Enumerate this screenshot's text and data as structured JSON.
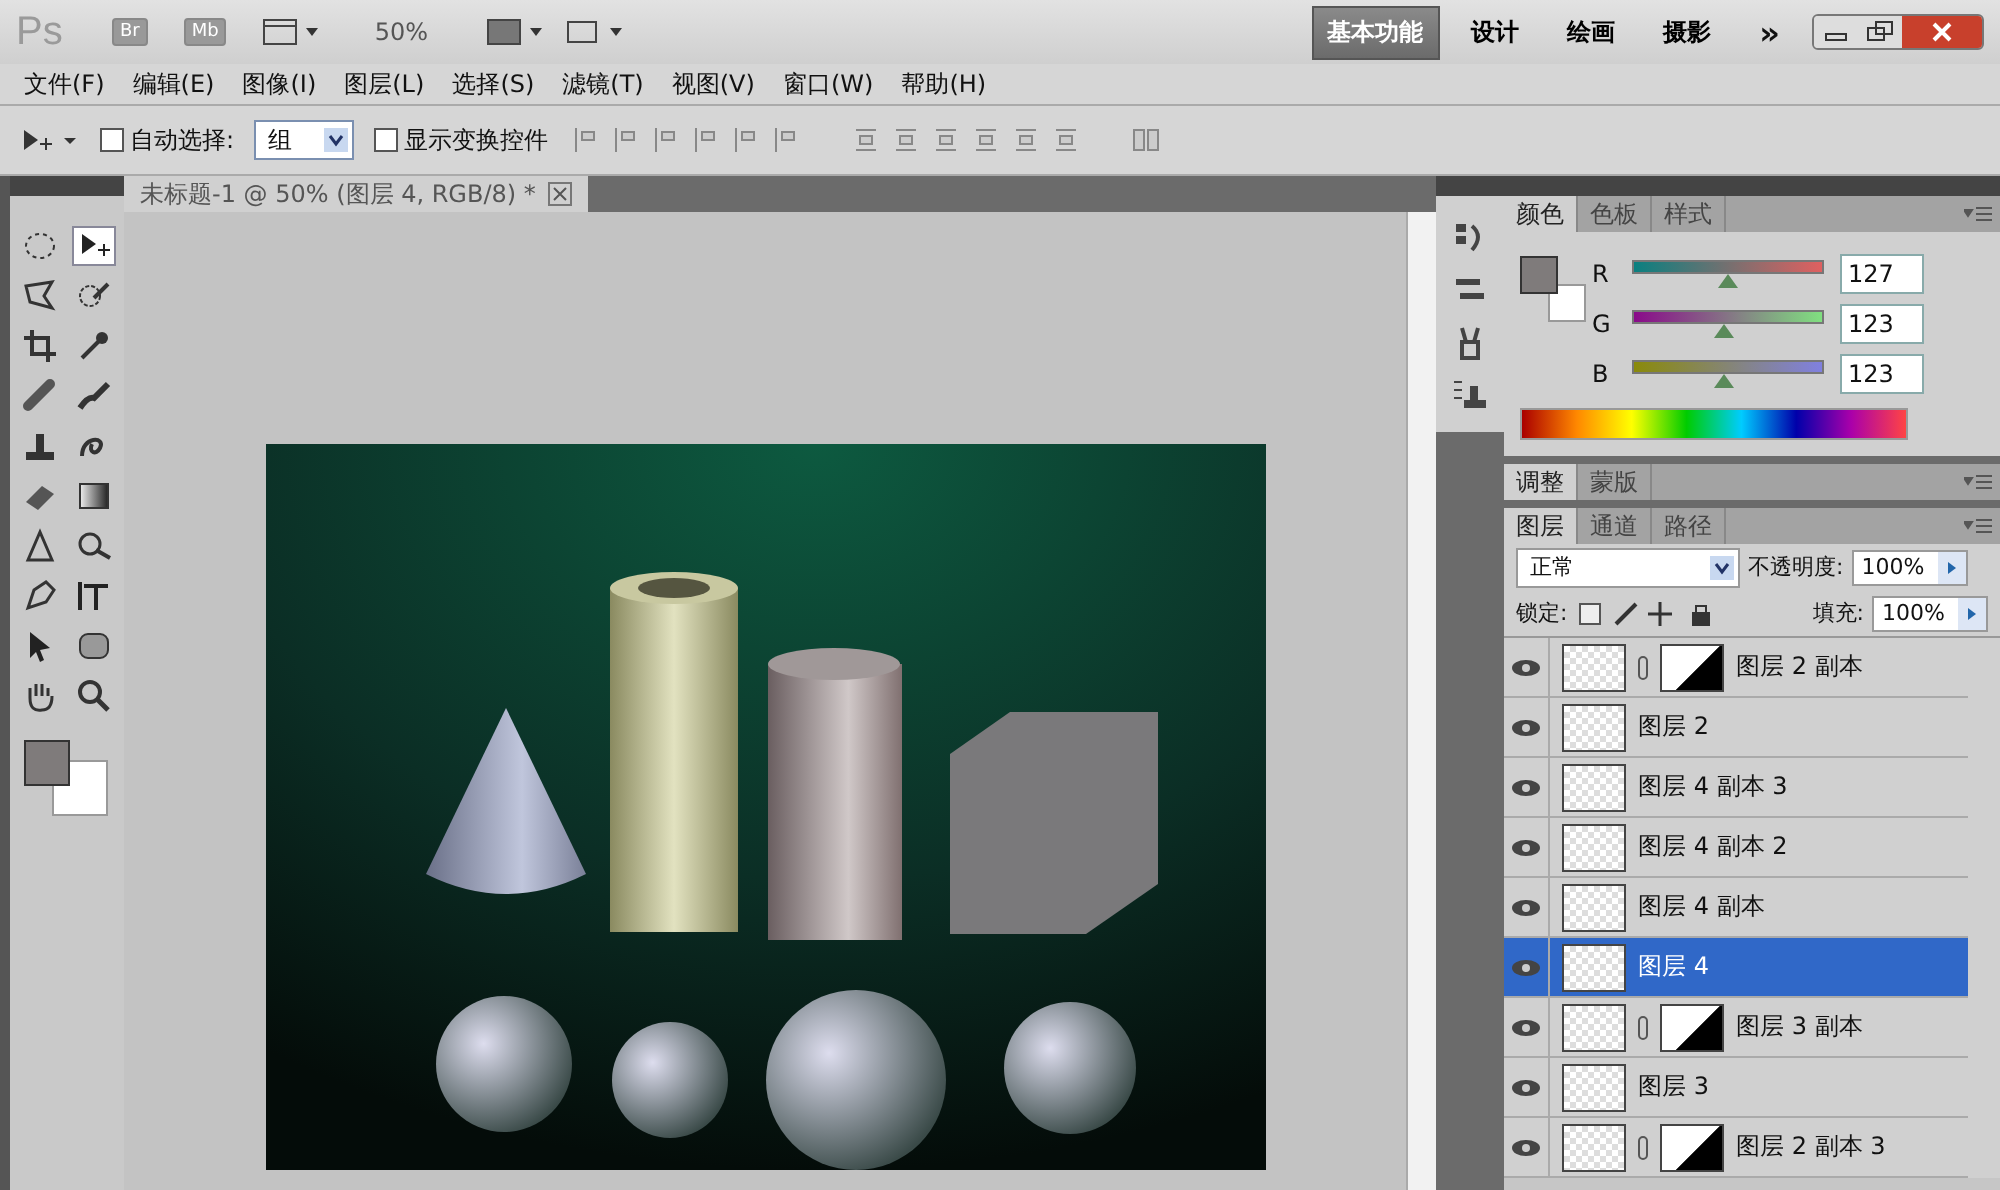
{
  "app_bar": {
    "logo": "Ps",
    "bridge": "Br",
    "mini_bridge": "Mb",
    "zoom": "50%",
    "more": "»",
    "workspaces": [
      {
        "label": "基本功能",
        "selected": true
      },
      {
        "label": "设计",
        "selected": false
      },
      {
        "label": "绘画",
        "selected": false
      },
      {
        "label": "摄影",
        "selected": false
      }
    ]
  },
  "menu": [
    "文件(F)",
    "编辑(E)",
    "图像(I)",
    "图层(L)",
    "选择(S)",
    "滤镜(T)",
    "视图(V)",
    "窗口(W)",
    "帮助(H)"
  ],
  "options_bar": {
    "auto_select": {
      "label": "自动选择:",
      "checked": false
    },
    "auto_select_mode": "组",
    "show_transform": {
      "label": "显示变换控件",
      "checked": false
    }
  },
  "document": {
    "tab_title": "未标题-1 @ 50% (图层 4, RGB/8) *"
  },
  "color_panel": {
    "tabs": [
      {
        "label": "颜色",
        "selected": true
      },
      {
        "label": "色板",
        "selected": false
      },
      {
        "label": "样式",
        "selected": false
      }
    ],
    "channels": [
      {
        "name": "R",
        "value": "127",
        "level": 0.5
      },
      {
        "name": "G",
        "value": "123",
        "level": 0.48
      },
      {
        "name": "B",
        "value": "123",
        "level": 0.48
      }
    ]
  },
  "adjust_panel": {
    "tabs": [
      {
        "label": "调整",
        "selected": true
      },
      {
        "label": "蒙版",
        "selected": false
      }
    ]
  },
  "layers_panel": {
    "tabs": [
      {
        "label": "图层",
        "selected": true
      },
      {
        "label": "通道",
        "selected": false
      },
      {
        "label": "路径",
        "selected": false
      }
    ],
    "blend_mode": "正常",
    "opacity_label": "不透明度:",
    "opacity": "100%",
    "lock_label": "锁定:",
    "fill_label": "填充:",
    "fill": "100%",
    "layers": [
      {
        "name": "图层 2 副本",
        "visible": true,
        "selected": false,
        "has_mask": true
      },
      {
        "name": "图层 2",
        "visible": true,
        "selected": false,
        "has_mask": false
      },
      {
        "name": "图层 4 副本 3",
        "visible": true,
        "selected": false,
        "has_mask": false
      },
      {
        "name": "图层 4 副本 2",
        "visible": true,
        "selected": false,
        "has_mask": false
      },
      {
        "name": "图层 4 副本",
        "visible": true,
        "selected": false,
        "has_mask": false
      },
      {
        "name": "图层 4",
        "visible": true,
        "selected": true,
        "has_mask": false
      },
      {
        "name": "图层 3 副本",
        "visible": true,
        "selected": false,
        "has_mask": true
      },
      {
        "name": "图层 3",
        "visible": true,
        "selected": false,
        "has_mask": false
      },
      {
        "name": "图层 2 副本 3",
        "visible": true,
        "selected": false,
        "has_mask": true
      }
    ]
  }
}
